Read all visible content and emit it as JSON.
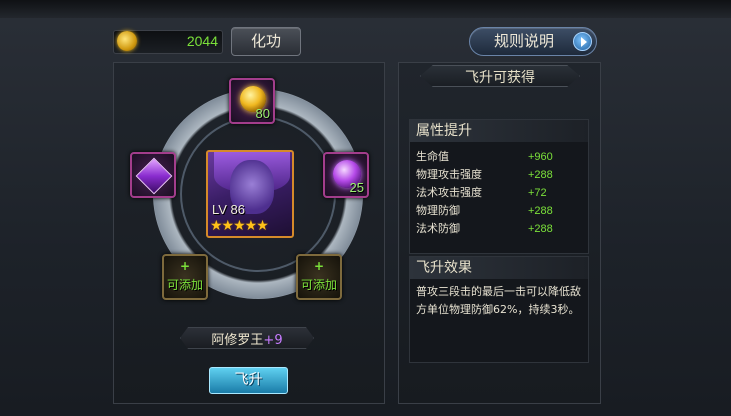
{
  "currency": {
    "icon": "gold-coin-icon",
    "amount": "2044"
  },
  "buttons": {
    "huagong": "化功",
    "rules": "规则说明",
    "ascend": "飞升"
  },
  "hero": {
    "level": "LV 86",
    "stars": "★★★★★",
    "star_count": 5,
    "name": "阿修罗王",
    "plus": "+9"
  },
  "slots": {
    "top": {
      "icon": "gold-orb-icon",
      "count": "80"
    },
    "left": {
      "icon": "purple-gem-icon",
      "count": ""
    },
    "right": {
      "icon": "purple-orb-icon",
      "count": "25"
    },
    "bottom_left": {
      "plus": "+",
      "label": "可添加"
    },
    "bottom_right": {
      "plus": "+",
      "label": "可添加"
    }
  },
  "right_panel": {
    "title": "飞升可获得",
    "attributes": {
      "heading": "属性提升",
      "rows": [
        {
          "name": "生命值",
          "value": "+960"
        },
        {
          "name": "物理攻击强度",
          "value": "+288"
        },
        {
          "name": "法术攻击强度",
          "value": "+72"
        },
        {
          "name": "物理防御",
          "value": "+288"
        },
        {
          "name": "法术防御",
          "value": "+288"
        }
      ]
    },
    "effect": {
      "heading": "飞升效果",
      "text": "普攻三段击的最后一击可以降低敌方单位物理防御62%，持续3秒。"
    }
  },
  "colors": {
    "positive": "#7be03a",
    "accent_purple": "#a33d8c",
    "button_blue": "#1a7ca8"
  }
}
